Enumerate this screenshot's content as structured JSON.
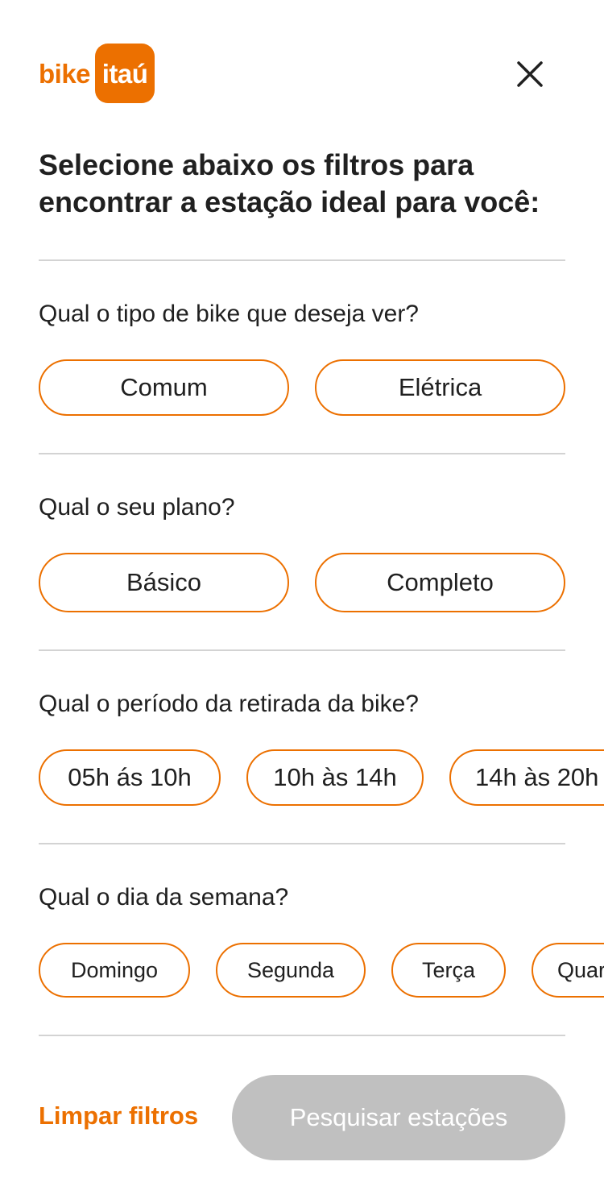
{
  "logo": {
    "text_left": "bike",
    "text_badge": "itaú"
  },
  "close_icon": "close-icon",
  "heading": "Selecione abaixo os filtros para encontrar a estação ideal para você:",
  "sections": {
    "bike_type": {
      "question": "Qual o tipo de bike que deseja ver?",
      "options": [
        "Comum",
        "Elétrica"
      ]
    },
    "plan": {
      "question": "Qual o seu plano?",
      "options": [
        "Básico",
        "Completo"
      ]
    },
    "period": {
      "question": "Qual o período da retirada da bike?",
      "options": [
        "05h ás 10h",
        "10h às 14h",
        "14h às 20h"
      ]
    },
    "weekday": {
      "question": "Qual o dia da semana?",
      "options": [
        "Domingo",
        "Segunda",
        "Terça",
        "Quarta"
      ]
    }
  },
  "footer": {
    "clear_label": "Limpar filtros",
    "search_label": "Pesquisar estações"
  },
  "colors": {
    "accent": "#ec7000",
    "disabled_button": "#c0c0c0",
    "divider": "#d3d3d3",
    "text": "#202020"
  }
}
